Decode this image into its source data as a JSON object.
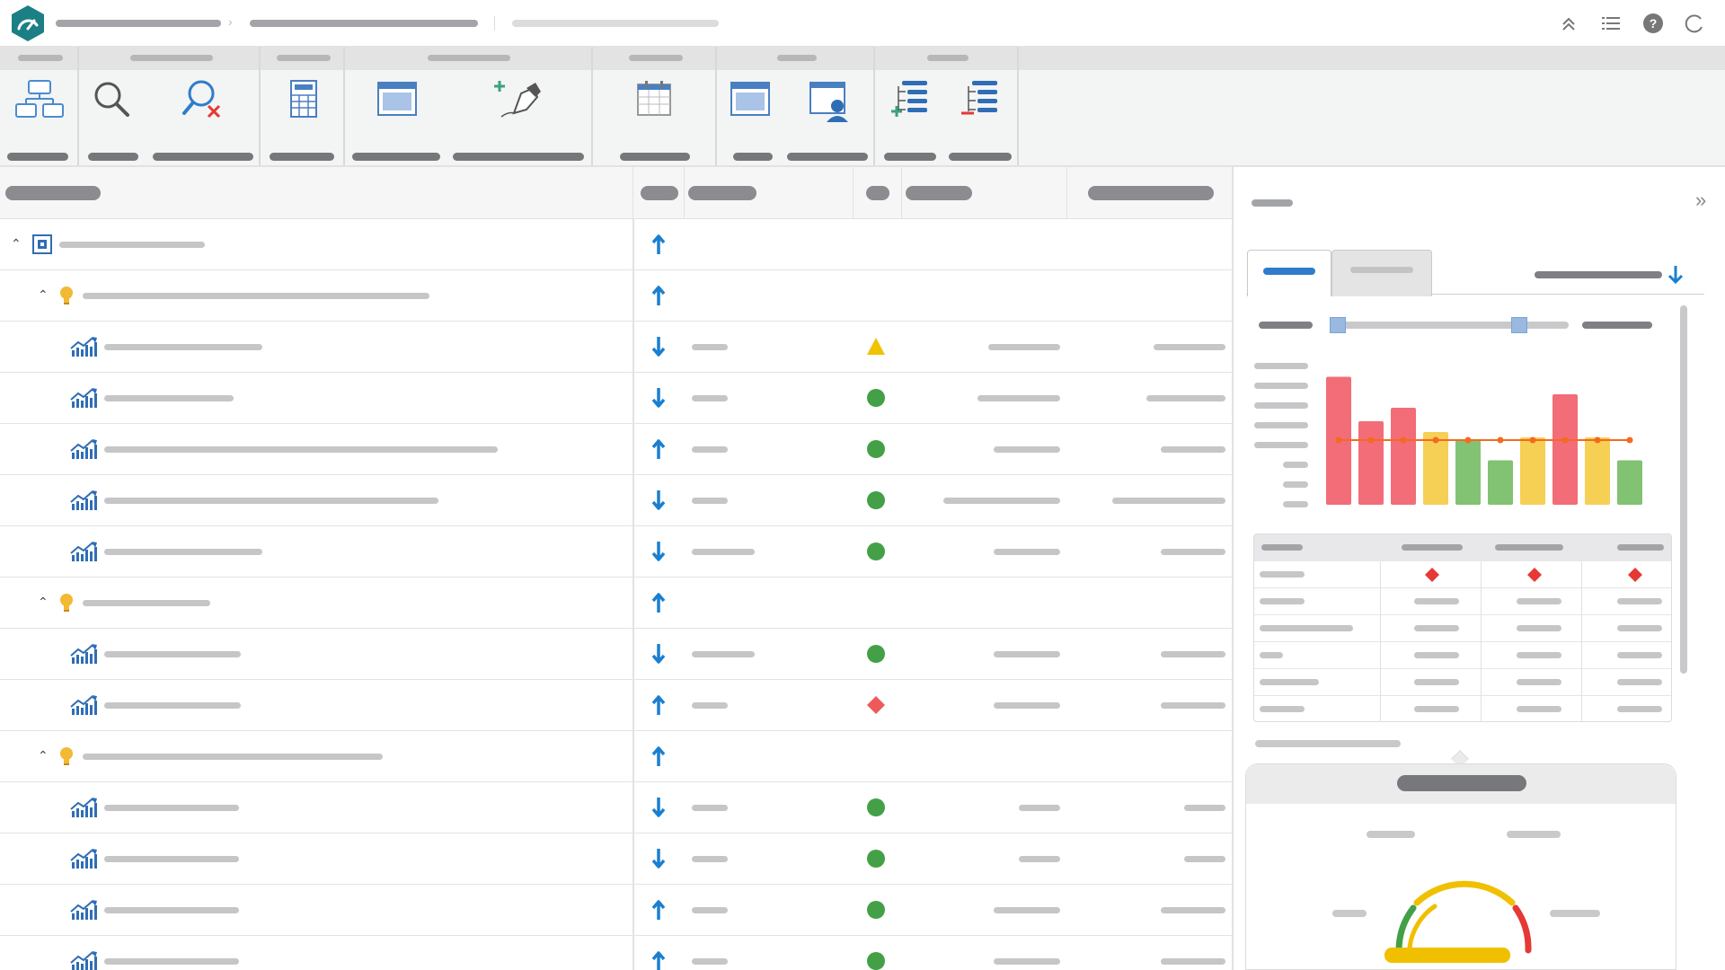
{
  "app": {
    "brand_color": "#1d7f86",
    "logo_icon": "gauge-logo-icon"
  },
  "topbar": {
    "icons": [
      "collapse-up-icon",
      "list-icon",
      "help-icon",
      "refresh-icon"
    ]
  },
  "ribbon": {
    "icons": [
      "hierarchy-icon",
      "search-icon",
      "search-clear-icon",
      "calculator-icon",
      "form-window-icon",
      "pen-add-icon",
      "calendar-icon",
      "window-icon",
      "user-card-icon",
      "add-list-icon",
      "remove-list-icon"
    ]
  },
  "grid": {
    "rows": [
      {
        "level": 0,
        "type": "scorecard",
        "trend": "up",
        "status": ""
      },
      {
        "level": 1,
        "type": "objective",
        "trend": "up",
        "status": ""
      },
      {
        "level": 2,
        "type": "kpi",
        "trend": "down",
        "status": "warning"
      },
      {
        "level": 2,
        "type": "kpi",
        "trend": "down",
        "status": "ok"
      },
      {
        "level": 2,
        "type": "kpi",
        "trend": "up",
        "status": "ok"
      },
      {
        "level": 2,
        "type": "kpi",
        "trend": "down",
        "status": "ok"
      },
      {
        "level": 2,
        "type": "kpi",
        "trend": "down",
        "status": "ok"
      },
      {
        "level": 1,
        "type": "objective",
        "trend": "up",
        "status": ""
      },
      {
        "level": 2,
        "type": "kpi",
        "trend": "down",
        "status": "ok"
      },
      {
        "level": 2,
        "type": "kpi",
        "trend": "up",
        "status": "critical"
      },
      {
        "level": 1,
        "type": "objective",
        "trend": "up",
        "status": ""
      },
      {
        "level": 2,
        "type": "kpi",
        "trend": "down",
        "status": "ok"
      },
      {
        "level": 2,
        "type": "kpi",
        "trend": "down",
        "status": "ok"
      },
      {
        "level": 2,
        "type": "kpi",
        "trend": "up",
        "status": "ok"
      },
      {
        "level": 2,
        "type": "kpi",
        "trend": "up",
        "status": "ok"
      }
    ]
  },
  "colors": {
    "up_arrow": "#1a7fd0",
    "ok": "#43a047",
    "warning": "#f2c200",
    "critical": "#ee5a5a",
    "bar_red": "#f26d77",
    "bar_yellow": "#f6cf55",
    "bar_green": "#82c273",
    "target_line": "#f46a1f",
    "gauge_yellow": "#f0c000"
  },
  "chart_data": {
    "type": "bar",
    "values": [
      95,
      62,
      72,
      54,
      48,
      33,
      50,
      82,
      50,
      33
    ],
    "bar_status": [
      "red",
      "red",
      "red",
      "yellow",
      "green",
      "green",
      "yellow",
      "red",
      "yellow",
      "green"
    ],
    "target": [
      48,
      48,
      48,
      48,
      48,
      48,
      48,
      48,
      48,
      48
    ],
    "ylim": [
      0,
      100
    ]
  },
  "panel": {
    "table_rows": [
      [
        "critical",
        "critical",
        "critical"
      ],
      [
        "",
        "",
        ""
      ],
      [
        "",
        "",
        ""
      ],
      [
        "",
        "",
        ""
      ],
      [
        "",
        "",
        ""
      ],
      [
        "",
        "",
        ""
      ]
    ]
  },
  "gauge": {
    "bands": [
      "green",
      "yellow",
      "red"
    ]
  }
}
